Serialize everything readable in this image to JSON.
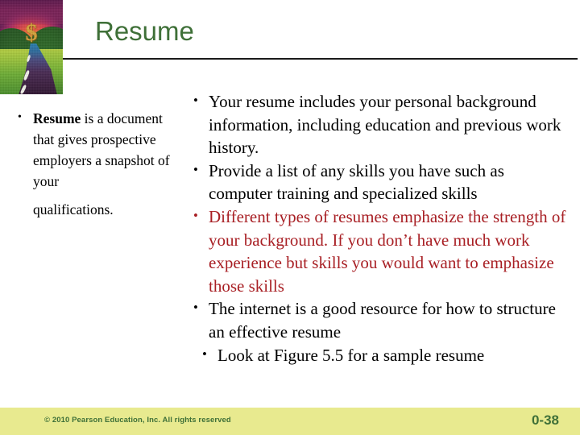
{
  "slide": {
    "title": "Resume",
    "title_color": "#3F7038",
    "accent_red": "#A81F24",
    "footer_band_color": "#E8EA8F"
  },
  "artwork": {
    "name": "sunset-road-dollar-illustration",
    "dollar_glyph": "$"
  },
  "left_column": {
    "bullets": [
      {
        "lead": "Resume",
        "body": " is a document that gives prospective employers a snapshot of your",
        "tail": "qualifications."
      }
    ]
  },
  "right_column": {
    "bullets": [
      {
        "text": "Your resume includes your personal background information, including education and previous work history.",
        "color": "black",
        "indented": false
      },
      {
        "text": "Provide a list of any skills you have such as computer training and specialized skills",
        "color": "black",
        "indented": false
      },
      {
        "text": "Different types of resumes emphasize the strength of your background. If you don’t have much work experience but skills you would want to emphasize those skills",
        "color": "red",
        "indented": false
      },
      {
        "text": "The internet is a good resource for how to structure an effective resume",
        "color": "black",
        "indented": false
      },
      {
        "text": "Look at Figure 5.5 for a sample resume",
        "color": "black",
        "indented": true
      }
    ]
  },
  "footer": {
    "copyright": "© 2010 Pearson Education, Inc. All rights reserved",
    "page_number": "0-38"
  }
}
